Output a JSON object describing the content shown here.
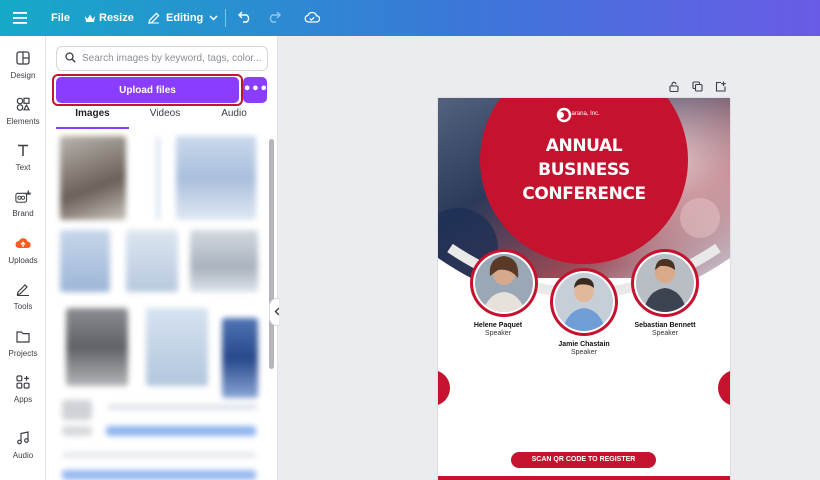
{
  "topbar": {
    "file_label": "File",
    "resize_label": "Resize",
    "editing_label": "Editing"
  },
  "rail": {
    "items": [
      {
        "label": "Design",
        "icon": "layout-icon"
      },
      {
        "label": "Elements",
        "icon": "shapes-icon"
      },
      {
        "label": "Text",
        "icon": "text-icon"
      },
      {
        "label": "Brand",
        "icon": "brand-icon"
      },
      {
        "label": "Uploads",
        "icon": "cloud-upload-icon"
      },
      {
        "label": "Tools",
        "icon": "pen-icon"
      },
      {
        "label": "Projects",
        "icon": "folder-icon"
      },
      {
        "label": "Apps",
        "icon": "apps-icon"
      },
      {
        "label": "Audio",
        "icon": "music-icon"
      }
    ]
  },
  "panel": {
    "search_placeholder": "Search images by keyword, tags, color...",
    "upload_label": "Upload files",
    "more_label": "•••",
    "tabs": [
      {
        "label": "Images",
        "active": true
      },
      {
        "label": "Videos",
        "active": false
      },
      {
        "label": "Audio",
        "active": false
      }
    ]
  },
  "design": {
    "company": "Larana, Inc.",
    "headline": [
      "ANNUAL",
      "BUSINESS",
      "CONFERENCE"
    ],
    "speakers": [
      {
        "name": "Helene Paquet",
        "role": "Speaker"
      },
      {
        "name": "Jamie Chastain",
        "role": "Speaker"
      },
      {
        "name": "Sebastian Bennett",
        "role": "Speaker"
      }
    ],
    "cta": "SCAN QR CODE TO REGISTER"
  },
  "colors": {
    "accent_purple": "#8b3dff",
    "brand_red": "#c4122f",
    "highlight_ring": "#c4122f"
  }
}
